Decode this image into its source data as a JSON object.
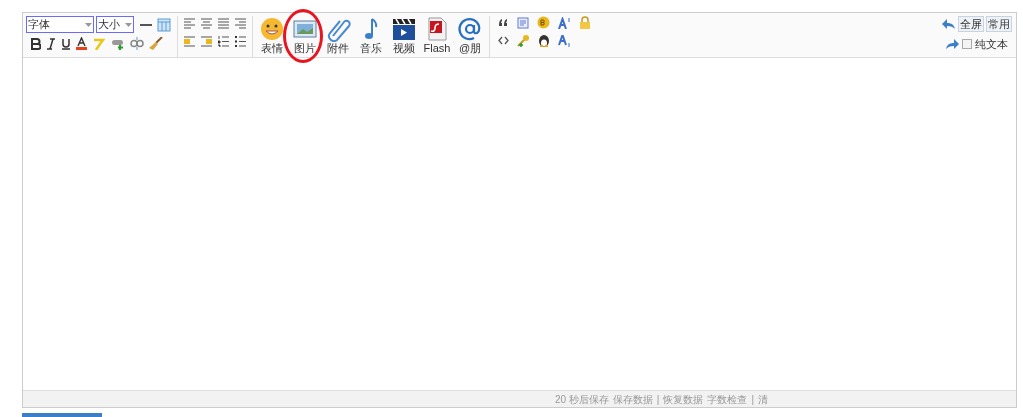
{
  "toolbar": {
    "font_select": "字体",
    "size_select": "大小",
    "media_buttons": [
      {
        "kind": "emoji",
        "label": "表情",
        "circled": false
      },
      {
        "kind": "image",
        "label": "图片",
        "circled": true
      },
      {
        "kind": "attach",
        "label": "附件",
        "circled": false
      },
      {
        "kind": "music",
        "label": "音乐",
        "circled": false
      },
      {
        "kind": "video",
        "label": "视频",
        "circled": false
      },
      {
        "kind": "flash",
        "label": "Flash",
        "circled": false
      },
      {
        "kind": "at",
        "label": "@朋",
        "circled": false
      }
    ],
    "right_buttons": [
      "全屏",
      "常用"
    ],
    "plain_text": {
      "label": "纯文本",
      "checked": false
    }
  },
  "status_bar": [
    "20 秒后保存",
    "保存数据",
    "|",
    "恢复数据",
    "字数检查",
    "|",
    "清"
  ]
}
